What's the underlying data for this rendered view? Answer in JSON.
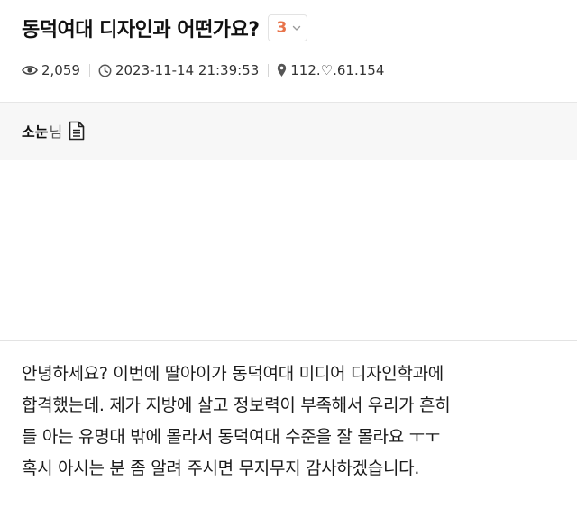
{
  "post": {
    "title": "동덕여대 디자인과 어떤가요?",
    "comment_count": "3",
    "views": "2,059",
    "datetime": "2023-11-14 21:39:53",
    "ip": "112.♡.61.154"
  },
  "author": {
    "name": "소눈",
    "suffix": "님"
  },
  "body": {
    "lines": [
      "안녕하세요? 이번에 딸아이가 동덕여대 미디어 디자인학과에",
      "합격했는데. 제가 지방에 살고 정보력이 부족해서 우리가 흔히",
      "들 아는 유명대 밖에 몰라서 동덕여대 수준을 잘 몰라요 ㅜㅜ",
      "혹시 아시는 분 좀 알려 주시면 무지무지 감사하겠습니다."
    ]
  },
  "icons": {
    "views": "eye-icon",
    "datetime": "clock-icon",
    "ip": "location-pin-icon",
    "comments_toggle": "chevron-down-icon",
    "author_posts": "document-icon"
  },
  "colors": {
    "comment_count": "#e8734a",
    "author_bar_bg": "#f7f7f7",
    "text": "#222222"
  }
}
